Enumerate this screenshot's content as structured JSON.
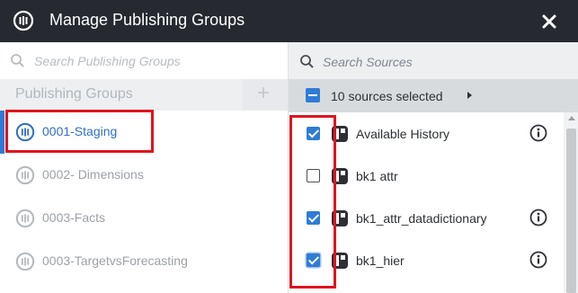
{
  "window": {
    "title": "Manage Publishing Groups",
    "icon": "publishing-group-icon",
    "close_icon": "close-icon"
  },
  "left_pane": {
    "search_placeholder": "Search Publishing Groups",
    "header_label": "Publishing Groups",
    "add_icon": "plus-icon",
    "groups": [
      {
        "name": "0001-Staging",
        "selected": true
      },
      {
        "name": "0002- Dimensions",
        "selected": false
      },
      {
        "name": "0003-Facts",
        "selected": false
      },
      {
        "name": "0003-TargetvsForecasting",
        "selected": false
      }
    ]
  },
  "right_pane": {
    "search_placeholder": "Search Sources",
    "selection_summary": "10 sources selected",
    "sources": [
      {
        "name": "Available History",
        "checked": true,
        "has_info": true
      },
      {
        "name": "bk1 attr",
        "checked": false,
        "has_info": false
      },
      {
        "name": "bk1_attr_datadictionary",
        "checked": true,
        "has_info": true
      },
      {
        "name": "bk1_hier",
        "checked": true,
        "has_info": true
      }
    ]
  },
  "colors": {
    "titlebar": "#262a30",
    "accent": "#2f7cd6",
    "annotation": "#e0141e"
  }
}
